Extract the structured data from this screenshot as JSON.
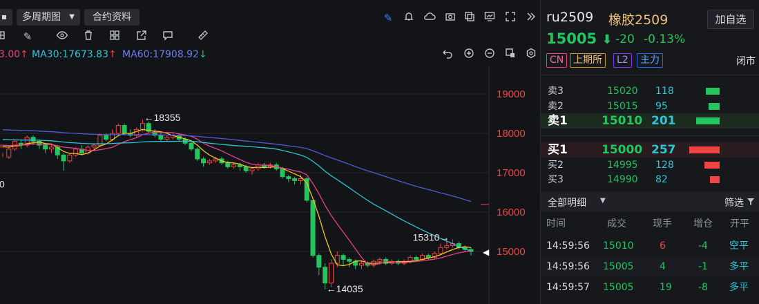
{
  "toolbar": {
    "period_label": "多周期图",
    "contract_info_label": "合约资料"
  },
  "ma_legend": {
    "ma_partial": "3.00",
    "ma30": "MA30:17673.83",
    "ma60": "MA60:17908.92"
  },
  "chart_data": {
    "type": "candlestick",
    "y_ticks": [
      "19000",
      "18000",
      "17000",
      "16000",
      "15000"
    ],
    "left_partial_tick": "0",
    "annotations": {
      "high": "←18355",
      "low": "←14035",
      "recent_high": "15310→"
    },
    "candles": [
      [
        17650,
        17700,
        17500,
        17400
      ],
      [
        17400,
        17600,
        17700,
        17350
      ],
      [
        17600,
        17800,
        17850,
        17550
      ],
      [
        17750,
        17700,
        17850,
        17600
      ],
      [
        17700,
        17900,
        17950,
        17650
      ],
      [
        17900,
        17800,
        17950,
        17700
      ],
      [
        17800,
        17700,
        17850,
        17600
      ],
      [
        17700,
        17600,
        17750,
        17500
      ],
      [
        17600,
        17650,
        17700,
        17500
      ],
      [
        17650,
        17450,
        17700,
        17350
      ],
      [
        17450,
        17300,
        17500,
        17050
      ],
      [
        17300,
        17450,
        17500,
        17250
      ],
      [
        17450,
        17600,
        17650,
        17400
      ],
      [
        17600,
        17500,
        17700,
        17450
      ],
      [
        17500,
        17650,
        17700,
        17450
      ],
      [
        17650,
        17700,
        17750,
        17600
      ],
      [
        17700,
        17950,
        18000,
        17650
      ],
      [
        17950,
        17850,
        18000,
        17800
      ],
      [
        17850,
        18000,
        18100,
        17800
      ],
      [
        18000,
        18200,
        18250,
        17950
      ],
      [
        18200,
        18000,
        18250,
        17950
      ],
      [
        18000,
        17950,
        18100,
        17900
      ],
      [
        17950,
        18100,
        18150,
        17900
      ],
      [
        18100,
        18250,
        18355,
        18050
      ],
      [
        18250,
        18050,
        18300,
        18000
      ],
      [
        18050,
        17950,
        18100,
        17900
      ],
      [
        17950,
        17850,
        18000,
        17800
      ],
      [
        17850,
        17900,
        17950,
        17800
      ],
      [
        17900,
        17950,
        18000,
        17850
      ],
      [
        17950,
        17850,
        18000,
        17800
      ],
      [
        17850,
        17750,
        17900,
        17700
      ],
      [
        17750,
        17600,
        17800,
        17550
      ],
      [
        17600,
        17350,
        17650,
        17300
      ],
      [
        17350,
        17250,
        17400,
        17150
      ],
      [
        17250,
        17300,
        17350,
        17200
      ],
      [
        17300,
        17350,
        17400,
        17250
      ],
      [
        17350,
        17250,
        17400,
        17200
      ],
      [
        17250,
        17150,
        17300,
        17100
      ],
      [
        17150,
        17200,
        17250,
        17100
      ],
      [
        17200,
        17150,
        17250,
        17050
      ],
      [
        17150,
        17050,
        17200,
        17000
      ],
      [
        17050,
        17100,
        17150,
        16950
      ],
      [
        17100,
        17200,
        17250,
        17050
      ],
      [
        17200,
        17150,
        17250,
        17100
      ],
      [
        17150,
        17200,
        17250,
        17100
      ],
      [
        17200,
        17100,
        17250,
        17050
      ],
      [
        17100,
        16900,
        17150,
        16850
      ],
      [
        16900,
        16850,
        16950,
        16750
      ],
      [
        16850,
        16800,
        16900,
        16700
      ],
      [
        16800,
        16850,
        16950,
        16700
      ],
      [
        16850,
        16300,
        16900,
        16250
      ],
      [
        16300,
        14900,
        16300,
        14850
      ],
      [
        14900,
        14600,
        14950,
        14400
      ],
      [
        14600,
        14200,
        14700,
        14035
      ],
      [
        14200,
        14700,
        14800,
        14100
      ],
      [
        14700,
        14900,
        15000,
        14600
      ],
      [
        14900,
        14800,
        14950,
        14650
      ],
      [
        14800,
        14750,
        14850,
        14600
      ],
      [
        14750,
        14650,
        14800,
        14550
      ],
      [
        14650,
        14700,
        14750,
        14550
      ],
      [
        14700,
        14650,
        14750,
        14600
      ],
      [
        14650,
        14750,
        14800,
        14600
      ],
      [
        14750,
        14800,
        14850,
        14700
      ],
      [
        14800,
        14700,
        14850,
        14650
      ],
      [
        14700,
        14750,
        14800,
        14650
      ],
      [
        14750,
        14700,
        14800,
        14650
      ],
      [
        14700,
        14750,
        14800,
        14650
      ],
      [
        14750,
        14850,
        14900,
        14700
      ],
      [
        14850,
        14800,
        14900,
        14750
      ],
      [
        14800,
        14900,
        14950,
        14750
      ],
      [
        14900,
        14850,
        14950,
        14800
      ],
      [
        14850,
        14950,
        15000,
        14800
      ],
      [
        14950,
        15100,
        15200,
        14900
      ],
      [
        15100,
        15150,
        15250,
        15050
      ],
      [
        15150,
        15200,
        15310,
        15100
      ],
      [
        15200,
        15100,
        15250,
        15050
      ],
      [
        15100,
        15050,
        15150,
        15000
      ],
      [
        15050,
        15000,
        15100,
        14900
      ]
    ],
    "ma_lines": {
      "ma5_color": "#f5c518",
      "ma10_color": "#e83e8c",
      "ma30_color": "#2ec4d6",
      "ma60_color": "#4f5bd5"
    },
    "current_marker": "◀",
    "ylim": [
      13900,
      19400
    ]
  },
  "header": {
    "symbol": "ru2509",
    "name": "橡胶2509",
    "add_watch": "加自选",
    "price": "15005",
    "change": "-20",
    "change_pct": "-0.13%",
    "tags": [
      "CN",
      "上期所",
      "L2",
      "主力"
    ],
    "status": "闭市"
  },
  "orderbook": {
    "asks": [
      {
        "label": "卖3",
        "price": "15020",
        "vol": "118",
        "bar": 0.2
      },
      {
        "label": "卖2",
        "price": "15015",
        "vol": "95",
        "bar": 0.16
      },
      {
        "label": "卖1",
        "price": "15010",
        "vol": "201",
        "bar": 0.34
      }
    ],
    "bids": [
      {
        "label": "买1",
        "price": "15000",
        "vol": "257",
        "bar": 0.44
      },
      {
        "label": "买2",
        "price": "14995",
        "vol": "128",
        "bar": 0.22
      },
      {
        "label": "买3",
        "price": "14990",
        "vol": "82",
        "bar": 0.14
      }
    ]
  },
  "trades": {
    "section_label": "全部明细",
    "filter_label": "筛选",
    "columns": [
      "时间",
      "成交",
      "现手",
      "增仓",
      "开平"
    ],
    "rows": [
      {
        "time": "14:59:56",
        "price": "15010",
        "qty": "6",
        "oi": "-4",
        "type": "空平"
      },
      {
        "time": "14:59:56",
        "price": "15005",
        "qty": "4",
        "oi": "-1",
        "type": "多平"
      },
      {
        "time": "14:59:57",
        "price": "15005",
        "qty": "19",
        "oi": "-8",
        "type": "多平"
      }
    ]
  },
  "colors": {
    "up": "#ef4444",
    "down": "#22c55e",
    "bg": "#131418"
  }
}
